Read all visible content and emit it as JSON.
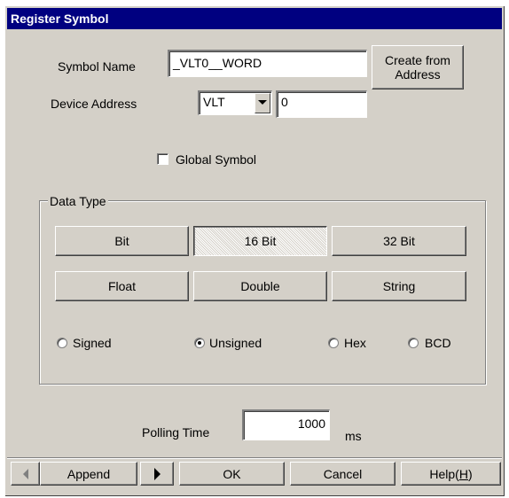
{
  "window": {
    "title": "Register Symbol"
  },
  "symbol_name": {
    "label": "Symbol Name",
    "value": "_VLT0__WORD"
  },
  "create_from_address_button": {
    "label_line1": "Create from",
    "label_line2": "Address"
  },
  "device_address": {
    "label": "Device Address",
    "device_value": "VLT",
    "address_value": "0"
  },
  "global_symbol": {
    "label": "Global Symbol",
    "checked": false
  },
  "data_type": {
    "legend": "Data Type",
    "buttons": [
      "Bit",
      "16 Bit",
      "32 Bit",
      "Float",
      "Double",
      "String"
    ],
    "selected": "16 Bit",
    "radios": [
      "Signed",
      "Unsigned",
      "Hex",
      "BCD"
    ],
    "selected_radio": "Unsigned"
  },
  "polling": {
    "label": "Polling Time",
    "value": "1000",
    "unit": "ms"
  },
  "footer": {
    "prev_icon": "left-arrow-icon",
    "append_label": "Append",
    "next_icon": "right-arrow-icon",
    "ok_label": "OK",
    "cancel_label": "Cancel",
    "help_label_text": "Help(",
    "help_accel": "H",
    "help_close": ")"
  }
}
